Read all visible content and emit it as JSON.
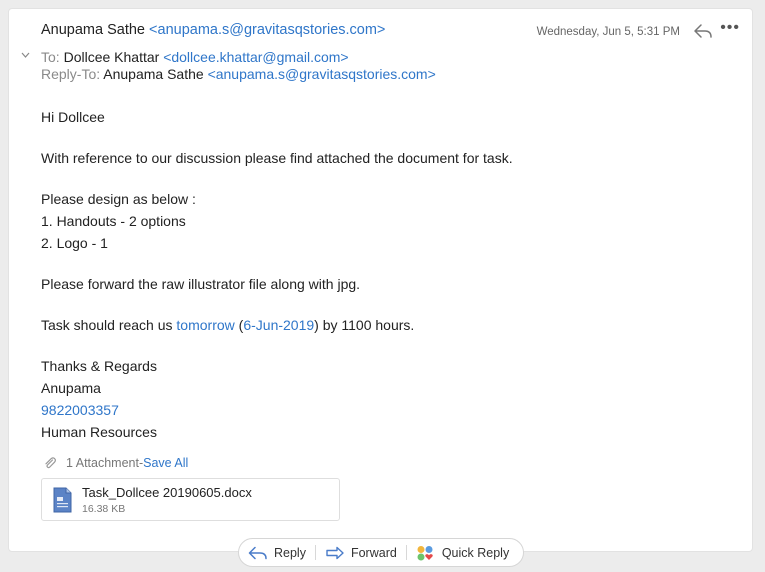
{
  "header": {
    "sender_name": "Anupama Sathe",
    "sender_email": "<anupama.s@gravitasqstories.com>",
    "date": "Wednesday, Jun 5, 5:31 PM",
    "to_label": "To:",
    "to_name": "Dollcee Khattar",
    "to_email": "<dollcee.khattar@gmail.com>",
    "replyto_label": "Reply-To:",
    "replyto_name": "Anupama Sathe",
    "replyto_email": "<anupama.s@gravitasqstories.com>",
    "more_glyph": "•••"
  },
  "body": {
    "greeting": "Hi Dollcee",
    "para1": "With reference to our discussion please find attached the document for task.",
    "design_intro": "Please design as below :",
    "item1": "1. Handouts - 2 options",
    "item2": "2. Logo - 1",
    "para3": "Please forward the raw illustrator file along with jpg.",
    "task_prefix": "Task should reach us ",
    "task_link1": "tomorrow",
    "task_mid": " (",
    "task_link2": "6-Jun-2019",
    "task_suffix": ") by 1100 hours.",
    "sign_thanks": "Thanks & Regards",
    "sign_name": "Anupama",
    "sign_phone": "9822003357",
    "sign_dept": "Human Resources"
  },
  "attachments": {
    "count_label": "1 Attachment",
    "separator": " - ",
    "save_all": "Save All",
    "file_name": "Task_Dollcee 20190605.docx",
    "file_size": "16.38 KB"
  },
  "actions": {
    "reply": "Reply",
    "forward": "Forward",
    "quick_reply": "Quick Reply"
  },
  "colors": {
    "link": "#2f76c9",
    "doc_icon": "#4a74b8"
  }
}
